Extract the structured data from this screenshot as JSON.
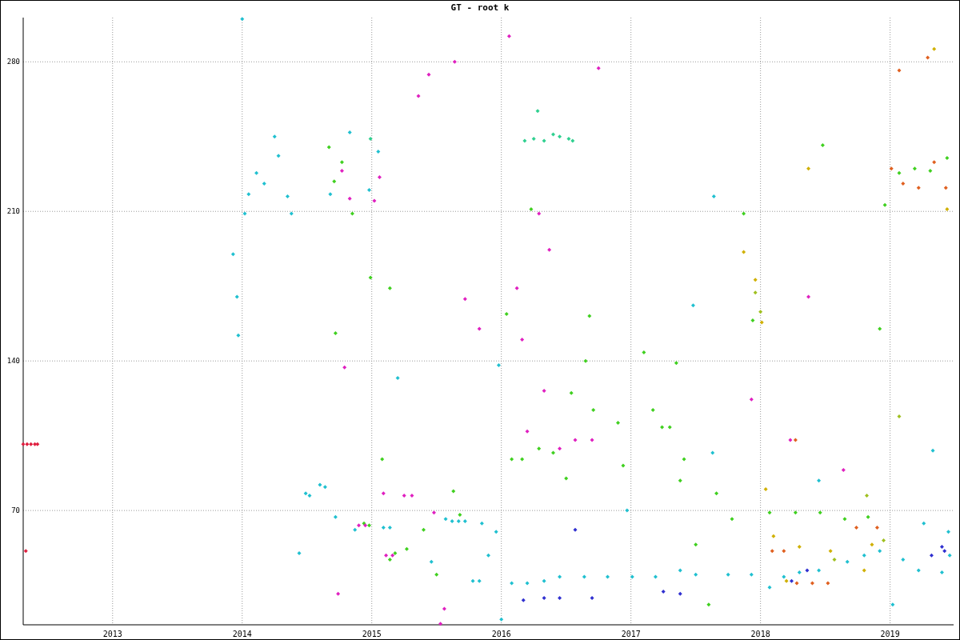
{
  "chart_data": {
    "type": "scatter",
    "title": "GT - root k",
    "xlim": [
      2012.31,
      2019.49
    ],
    "ylim": [
      16.5,
      300.7
    ],
    "xticks": [
      2013,
      2014,
      2015,
      2016,
      2017,
      2018,
      2019
    ],
    "yticks": [
      70,
      140,
      210,
      280
    ],
    "grid": true,
    "series": [
      {
        "color": "#e02040",
        "x": [
          2012.31,
          2012.34,
          2012.37,
          2012.4,
          2012.42,
          2012.33
        ],
        "values": [
          101,
          101,
          101,
          101,
          101,
          51
        ]
      },
      {
        "color": "#20c0d0",
        "x": [
          2014.0,
          2013.93,
          2013.96,
          2013.97,
          2014.02,
          2014.05,
          2014.11,
          2014.17,
          2014.25,
          2014.28,
          2014.35,
          2014.38,
          2014.49,
          2014.52,
          2014.6,
          2014.64,
          2014.44,
          2014.72,
          2014.87,
          2014.68,
          2014.83,
          2014.98,
          2015.05,
          2015.2,
          2015.09,
          2015.14,
          2015.46,
          2015.57,
          2015.62,
          2015.67,
          2015.72,
          2015.85,
          2015.78,
          2015.83,
          2015.9,
          2015.98,
          2015.96,
          2016.0,
          2016.08,
          2016.2,
          2016.33,
          2016.45,
          2016.64,
          2016.82,
          2016.97,
          2017.01,
          2017.19,
          2017.38,
          2017.5,
          2017.63,
          2017.48,
          2017.64,
          2017.75,
          2017.93,
          2018.07,
          2018.18,
          2018.3,
          2018.45,
          2018.45,
          2018.67,
          2018.8,
          2018.92,
          2019.02,
          2019.1,
          2019.22,
          2019.33,
          2019.26,
          2019.4,
          2019.45,
          2019.46
        ],
        "values": [
          300,
          190,
          170,
          152,
          209,
          218,
          228,
          223,
          245,
          236,
          217,
          209,
          78,
          77,
          82,
          81,
          50,
          67,
          61,
          218,
          247,
          220,
          238,
          132,
          62,
          62,
          46,
          66,
          65,
          65,
          65,
          64,
          37,
          37,
          49,
          138,
          60,
          19,
          36,
          36,
          37,
          39,
          39,
          39,
          70,
          39,
          39,
          42,
          40,
          97,
          166,
          217,
          40,
          40,
          34,
          39,
          41,
          42,
          84,
          46,
          49,
          51,
          26,
          47,
          42,
          98,
          64,
          41,
          60,
          49
        ]
      },
      {
        "color": "#30d090",
        "x": [
          2016.18,
          2016.25,
          2016.33,
          2016.4,
          2016.45,
          2016.52,
          2016.55,
          2016.28,
          2014.99
        ],
        "values": [
          243,
          244,
          243,
          246,
          245,
          244,
          243,
          257,
          244
        ]
      },
      {
        "color": "#40d020",
        "x": [
          2014.67,
          2014.71,
          2014.77,
          2014.85,
          2014.72,
          2014.99,
          2015.14,
          2014.98,
          2014.94,
          2015.14,
          2015.18,
          2015.08,
          2015.27,
          2015.4,
          2015.5,
          2015.63,
          2015.68,
          2016.08,
          2016.04,
          2016.16,
          2016.23,
          2016.29,
          2016.4,
          2016.5,
          2016.54,
          2016.71,
          2016.68,
          2016.65,
          2016.9,
          2016.94,
          2017.1,
          2017.17,
          2017.24,
          2017.3,
          2017.35,
          2017.38,
          2017.41,
          2017.5,
          2017.66,
          2017.6,
          2017.78,
          2017.87,
          2017.94,
          2018.07,
          2018.27,
          2018.46,
          2018.65,
          2018.83,
          2018.92,
          2018.96,
          2019.07,
          2019.19,
          2019.31,
          2019.44,
          2018.48
        ],
        "values": [
          240,
          224,
          233,
          209,
          153,
          179,
          174,
          63,
          64,
          47,
          50,
          94,
          52,
          61,
          40,
          79,
          68,
          94,
          162,
          94,
          211,
          99,
          97,
          85,
          125,
          117,
          161,
          140,
          111,
          91,
          144,
          117,
          109,
          109,
          139,
          84,
          94,
          54,
          78,
          26,
          66,
          209,
          159,
          69,
          69,
          69,
          66,
          67,
          155,
          213,
          228,
          230,
          229,
          235,
          241
        ]
      },
      {
        "color": "#e020c0",
        "x": [
          2014.77,
          2014.83,
          2015.02,
          2015.06,
          2014.9,
          2014.95,
          2015.09,
          2015.25,
          2015.31,
          2015.11,
          2015.16,
          2015.36,
          2015.44,
          2015.64,
          2015.48,
          2015.56,
          2015.53,
          2015.72,
          2015.83,
          2016.06,
          2016.12,
          2016.16,
          2016.29,
          2016.37,
          2016.2,
          2016.33,
          2016.45,
          2016.57,
          2016.7,
          2016.75,
          2017.93,
          2018.23,
          2018.37,
          2018.64,
          2014.74,
          2014.79
        ],
        "values": [
          229,
          216,
          215,
          226,
          63,
          63,
          78,
          77,
          77,
          49,
          49,
          264,
          274,
          280,
          69,
          24,
          17,
          169,
          155,
          292,
          174,
          150,
          209,
          192,
          107,
          126,
          99,
          103,
          103,
          277,
          122,
          103,
          170,
          89,
          31,
          137
        ]
      },
      {
        "color": "#3030d0",
        "x": [
          2016.17,
          2016.33,
          2016.45,
          2016.57,
          2016.7,
          2017.25,
          2017.38,
          2018.24,
          2018.36,
          2019.32,
          2019.4,
          2019.42
        ],
        "values": [
          28,
          29,
          29,
          61,
          29,
          32,
          31,
          37,
          42,
          49,
          53,
          51
        ]
      },
      {
        "color": "#e06020",
        "x": [
          2019.07,
          2019.29,
          2018.09,
          2018.18,
          2018.28,
          2018.4,
          2018.52,
          2018.74,
          2018.9,
          2019.01,
          2019.1,
          2019.22,
          2019.34,
          2019.43,
          2018.27
        ],
        "values": [
          276,
          282,
          51,
          51,
          36,
          36,
          36,
          62,
          62,
          230,
          223,
          221,
          233,
          221,
          103
        ]
      },
      {
        "color": "#d0b000",
        "x": [
          2017.87,
          2017.96,
          2018.01,
          2018.04,
          2018.1,
          2018.2,
          2018.3,
          2018.54,
          2018.8,
          2018.86,
          2019.34,
          2019.44,
          2018.37
        ],
        "values": [
          191,
          178,
          158,
          80,
          58,
          37,
          53,
          51,
          42,
          54,
          286,
          211,
          230
        ]
      },
      {
        "color": "#a0c020",
        "x": [
          2017.96,
          2018.0,
          2018.57,
          2018.82,
          2019.07,
          2018.95
        ],
        "values": [
          172,
          163,
          47,
          77,
          114,
          56
        ]
      }
    ]
  }
}
